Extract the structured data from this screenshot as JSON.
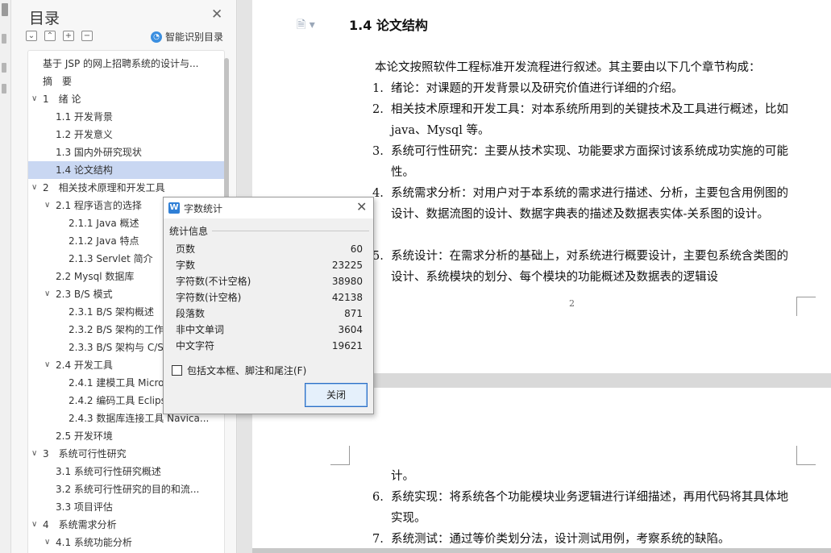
{
  "toc": {
    "title": "目录",
    "smart_label": "智能识别目录",
    "items": [
      {
        "label": "基于 JSP 的网上招聘系统的设计与...",
        "level": 0,
        "chev": ""
      },
      {
        "label": "摘　要",
        "level": 0,
        "chev": ""
      },
      {
        "label": "1　绪  论",
        "level": 1,
        "chev": "∨"
      },
      {
        "label": "1.1  开发背景",
        "level": 2,
        "chev": ""
      },
      {
        "label": "1.2  开发意义",
        "level": 2,
        "chev": ""
      },
      {
        "label": "1.3  国内外研究现状",
        "level": 2,
        "chev": ""
      },
      {
        "label": "1.4  论文结构",
        "level": 2,
        "chev": "",
        "active": true
      },
      {
        "label": "2　相关技术原理和开发工具",
        "level": 1,
        "chev": "∨"
      },
      {
        "label": "2.1  程序语言的选择",
        "level": 2,
        "chev": "∨"
      },
      {
        "label": "2.1.1 Java 概述",
        "level": 3,
        "chev": ""
      },
      {
        "label": "2.1.2 Java 特点",
        "level": 3,
        "chev": ""
      },
      {
        "label": "2.1.3 Servlet 简介",
        "level": 3,
        "chev": ""
      },
      {
        "label": "2.2 Mysql 数据库",
        "level": 2,
        "chev": ""
      },
      {
        "label": "2.3 B/S 模式",
        "level": 2,
        "chev": "∨"
      },
      {
        "label": "2.3.1 B/S 架构概述",
        "level": 3,
        "chev": ""
      },
      {
        "label": "2.3.2 B/S 架构的工作原理",
        "level": 3,
        "chev": ""
      },
      {
        "label": "2.3.3 B/S 架构与 C/S 架构",
        "level": 3,
        "chev": ""
      },
      {
        "label": "2.4  开发工具",
        "level": 2,
        "chev": "∨"
      },
      {
        "label": "2.4.1  建模工具 Microsoft",
        "level": 3,
        "chev": ""
      },
      {
        "label": "2.4.2  编码工具 Eclipse",
        "level": 3,
        "chev": ""
      },
      {
        "label": "2.4.3  数据库连接工具 Navica...",
        "level": 3,
        "chev": ""
      },
      {
        "label": "2.5  开发环境",
        "level": 2,
        "chev": ""
      },
      {
        "label": "3　系统可行性研究",
        "level": 1,
        "chev": "∨"
      },
      {
        "label": "3.1 系统可行性研究概述",
        "level": 2,
        "chev": ""
      },
      {
        "label": "3.2 系统可行性研究的目的和流...",
        "level": 2,
        "chev": ""
      },
      {
        "label": "3.3 项目评估",
        "level": 2,
        "chev": ""
      },
      {
        "label": "4　系统需求分析",
        "level": 1,
        "chev": "∨"
      },
      {
        "label": "4.1 系统功能分析",
        "level": 2,
        "chev": "∨"
      }
    ]
  },
  "document": {
    "heading": "1.4  论文结构",
    "intro": "本论文按照软件工程标准开发流程进行叙述。其主要由以下几个章节构成：",
    "page_number": "2",
    "items_page1": [
      {
        "num": "1.",
        "text": "绪论：对课题的开发背景以及研究价值进行详细的介绍。"
      },
      {
        "num": "2.",
        "text": "相关技术原理和开发工具：对本系统所用到的关键技术及工具进行概述，比如 java、Mysql 等。"
      },
      {
        "num": "3.",
        "text": "系统可行性研究：主要从技术实现、功能要求方面探讨该系统成功实施的可能性。"
      },
      {
        "num": "4.",
        "text": "系统需求分析：对用户对于本系统的需求进行描述、分析，主要包含用例图的设计、数据流图的设计、数据字典表的描述及数据表实体-关系图的设计。"
      },
      {
        "num": "5.",
        "text": "系统设计：在需求分析的基础上，对系统进行概要设计，主要包系统含类图的设计、系统模块的划分、每个模块的功能概述及数据表的逻辑设"
      }
    ],
    "continuation": "计。",
    "items_page2": [
      {
        "num": "6.",
        "text": "系统实现：将系统各个功能模块业务逻辑进行详细描述，再用代码将其具体地实现。"
      },
      {
        "num": "7.",
        "text": "系统测试：通过等价类划分法，设计测试用例，考察系统的缺陷。"
      }
    ]
  },
  "dialog": {
    "title": "字数统计",
    "section": "统计信息",
    "stats": [
      {
        "label": "页数",
        "value": "60"
      },
      {
        "label": "字数",
        "value": "23225"
      },
      {
        "label": "字符数(不计空格)",
        "value": "38980"
      },
      {
        "label": "字符数(计空格)",
        "value": "42138"
      },
      {
        "label": "段落数",
        "value": "871"
      },
      {
        "label": "非中文单词",
        "value": "3604"
      },
      {
        "label": "中文字符",
        "value": "19621"
      }
    ],
    "checkbox_label": "包括文本框、脚注和尾注(F)",
    "close_label": "关闭"
  }
}
